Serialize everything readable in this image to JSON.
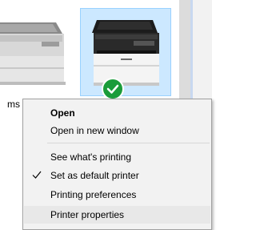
{
  "desktop": {
    "label_fragment": "ms"
  },
  "context_menu": {
    "items": [
      {
        "label": "Open",
        "bold": true
      },
      {
        "label": "Open in new window"
      },
      {
        "label": "See what's printing"
      },
      {
        "label": "Set as default printer",
        "checked": true
      },
      {
        "label": "Printing preferences"
      },
      {
        "label": "Printer properties",
        "highlighted": true
      }
    ]
  },
  "colors": {
    "selection_fill": "#cce8ff",
    "selection_border": "#99d1ff",
    "default_badge": "#1a9c3a",
    "menu_bg": "#f2f2f2"
  }
}
